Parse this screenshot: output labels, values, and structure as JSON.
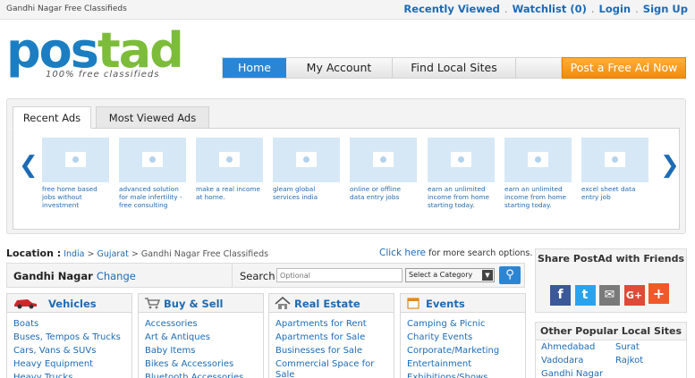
{
  "topbar": {
    "site_label": "Gandhi Nagar Free Classifieds",
    "links": [
      "Recently Viewed",
      "Watchlist",
      "(0)",
      "Login",
      "Sign Up"
    ]
  },
  "logo": {
    "word_a": "pos",
    "word_b": "tad",
    "tagline": "100% free classifieds"
  },
  "nav": {
    "home": "Home",
    "account": "My Account",
    "local": "Find Local Sites",
    "post": "Post a Free Ad Now"
  },
  "ads": {
    "tabs": [
      "Recent Ads",
      "Most Viewed Ads"
    ],
    "items": [
      "free home based jobs without investment",
      "advanced solution for male infertility - free consulting",
      "make a real income at home.",
      "gleam global services india",
      "online or offline data entry jobs",
      "earn an unlimited income from home starting today.",
      "earn an unlimited income from home starting today.",
      "excel sheet data entry job"
    ]
  },
  "location": {
    "label": "Location :",
    "india": "India",
    "gujarat": "Gujarat",
    "sep": ">",
    "current": "Gandhi Nagar Free Classifieds",
    "click_here": "Click here",
    "click_rest": "for more search options."
  },
  "search": {
    "city": "Gandhi Nagar",
    "change": "Change",
    "label": "Search",
    "placeholder": "Optional",
    "category": "Select a Category"
  },
  "categories": [
    {
      "title": "Vehicles",
      "icon": "car-icon",
      "items": [
        "Boats",
        "Buses, Tempos & Trucks",
        "Cars, Vans & SUVs",
        "Heavy Equipment",
        "Heavy Trucks"
      ]
    },
    {
      "title": "Buy & Sell",
      "icon": "cart-icon",
      "items": [
        "Accessories",
        "Art & Antiques",
        "Baby Items",
        "Bikes & Accessories",
        "Bluetooth Accessories"
      ]
    },
    {
      "title": "Real Estate",
      "icon": "house-icon",
      "items": [
        "Apartments for Rent",
        "Apartments for Sale",
        "Businesses for Sale",
        "Commercial Space for Sale"
      ]
    },
    {
      "title": "Events",
      "icon": "calendar-icon",
      "items": [
        "Camping & Picnic",
        "Charity Events",
        "Corporate/Marketing",
        "Entertainment",
        "Exhibitions/Shows"
      ]
    }
  ],
  "share": {
    "title": "Share PostAd with Friends",
    "glyphs": [
      "f",
      "t",
      "✉",
      "G+",
      "+"
    ]
  },
  "popular": {
    "title": "Other Popular Local Sites",
    "cities": [
      "Ahmedabad",
      "Surat",
      "Vadodara",
      "Rajkot",
      "Gandhi Nagar"
    ]
  },
  "colors": {
    "brand_blue": "#2a86d4",
    "brand_green": "#7cbc3a",
    "post_orange": "#f28a0e",
    "link": "#1d6bb5"
  }
}
